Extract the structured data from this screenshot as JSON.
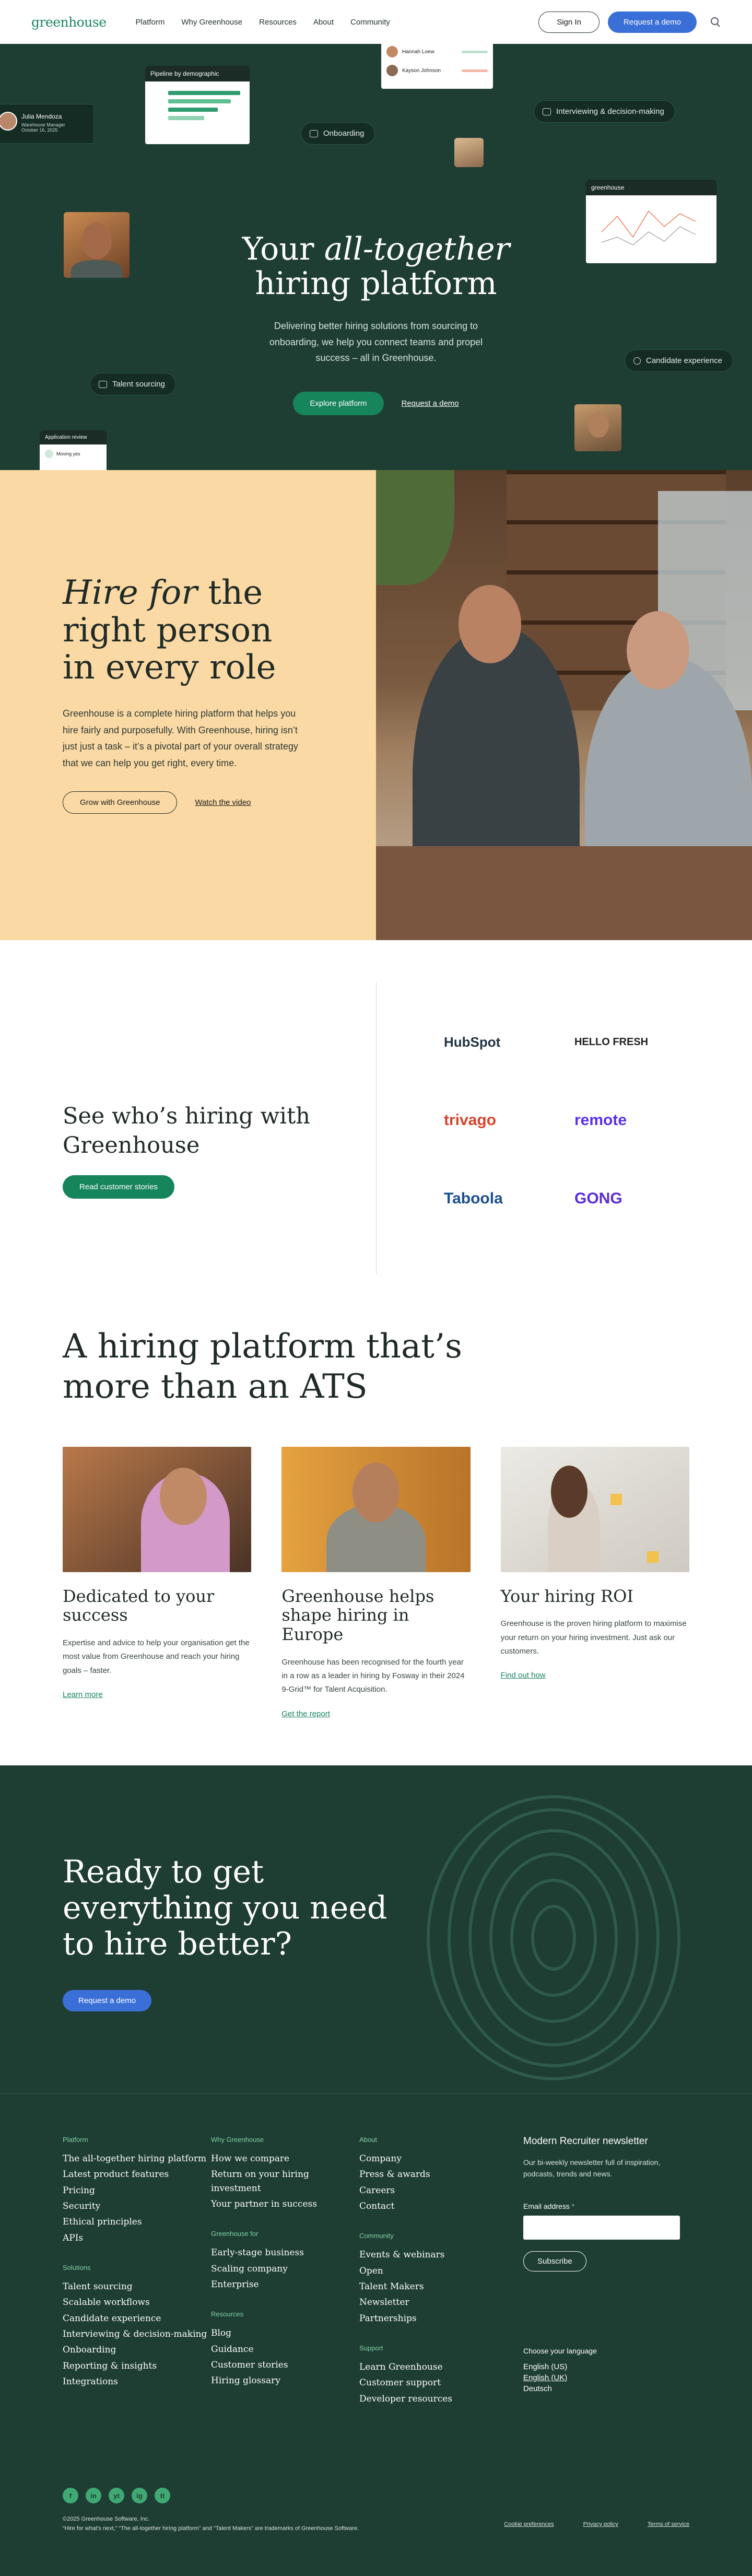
{
  "nav": {
    "logo": "greenhouse",
    "links": [
      "Platform",
      "Why Greenhouse",
      "Resources",
      "About",
      "Community"
    ],
    "signin": "Sign In",
    "demo": "Request a demo"
  },
  "hero": {
    "title_pre": "Your ",
    "title_em": "all-together",
    "title_post": "hiring platform",
    "subtitle": "Delivering better hiring solutions from sourcing to onboarding, we help you connect teams and propel success – all in Greenhouse.",
    "cta_primary": "Explore platform",
    "cta_secondary": "Request a demo",
    "pills": [
      "Onboarding",
      "Interviewing & decision-making",
      "Candidate experience",
      "Talent sourcing"
    ],
    "profile_card": {
      "name": "Julia Mendoza",
      "line1": "Warehouse Manager",
      "line2": "October 16, 2025"
    },
    "pipeline_card": {
      "title": "Pipeline by demographic"
    },
    "chart_card": {
      "title": "greenhouse"
    },
    "app_card": {
      "title": "Application review",
      "label": "Moving yes"
    },
    "top_card": {
      "row1": "Hannah Loew",
      "row2": "Kayson Johnson"
    }
  },
  "hire": {
    "title_em": "Hire for",
    "title_rest": " the right person in every role",
    "body": "Greenhouse is a complete hiring platform that helps you hire fairly and purposefully. With Greenhouse, hiring isn’t just just a task – it’s a pivotal part of your overall strategy that we can help you get right, every time.",
    "btn": "Grow with Greenhouse",
    "link": "Watch the video"
  },
  "who": {
    "title": "See who’s hiring with Greenhouse",
    "btn": "Read customer stories",
    "logos": [
      "HubSpot",
      "HELLO FRESH",
      "trivago",
      "remote",
      "Taboola",
      "GONG"
    ]
  },
  "ats": {
    "title": "A hiring platform that’s more than an ATS",
    "cards": [
      {
        "title": "Dedicated to your success",
        "body": "Expertise and advice to help your organisation get the most value from Greenhouse and reach your hiring goals – faster.",
        "link": "Learn more"
      },
      {
        "title": "Greenhouse helps shape hiring in Europe",
        "body": "Greenhouse has been recognised for the fourth year in a row as a leader in hiring by Fosway in their 2024 9-Grid™ for Talent Acquisition.",
        "link": "Get the report"
      },
      {
        "title": "Your hiring ROI",
        "body": "Greenhouse is the proven hiring platform to maximise your return on your hiring investment. Just ask our customers.",
        "link": "Find out how"
      }
    ]
  },
  "ready": {
    "title": "Ready to get everything you need to hire better?",
    "btn": "Request a demo"
  },
  "footer": {
    "platform": {
      "head": "Platform",
      "items": [
        "The all-together hiring platform",
        "Latest product features",
        "Pricing",
        "Security",
        "Ethical principles",
        "APIs"
      ]
    },
    "solutions": {
      "head": "Solutions",
      "items": [
        "Talent sourcing",
        "Scalable workflows",
        "Candidate experience",
        "Interviewing & decision-making",
        "Onboarding",
        "Reporting & insights",
        "Integrations"
      ]
    },
    "why": {
      "head": "Why Greenhouse",
      "items": [
        "How we compare",
        "Return on your hiring investment",
        "Your partner in success"
      ]
    },
    "for": {
      "head": "Greenhouse for",
      "items": [
        "Early-stage business",
        "Scaling company",
        "Enterprise"
      ]
    },
    "resources": {
      "head": "Resources",
      "items": [
        "Blog",
        "Guidance",
        "Customer stories",
        "Hiring glossary"
      ]
    },
    "about": {
      "head": "About",
      "items": [
        "Company",
        "Press & awards",
        "Careers",
        "Contact"
      ]
    },
    "community": {
      "head": "Community",
      "items": [
        "Events & webinars",
        "Open",
        "Talent Makers",
        "Newsletter",
        "Partnerships"
      ]
    },
    "support": {
      "head": "Support",
      "items": [
        "Learn Greenhouse",
        "Customer support",
        "Developer resources"
      ]
    },
    "newsletter": {
      "title": "Modern Recruiter newsletter",
      "body": "Our bi-weekly newsletter full of inspiration, podcasts, trends and news.",
      "email_label": "Email address",
      "required": "*",
      "subscribe": "Subscribe"
    },
    "language": {
      "label": "Choose your language",
      "options": [
        "English (US)",
        "English (UK)",
        "Deutsch"
      ]
    },
    "socials": [
      "f",
      "in",
      "yt",
      "ig",
      "tt"
    ],
    "copyright": "©2025 Greenhouse Software, Inc.",
    "trademark": "“Hire for what’s next,” “The all-together hiring platform” and “Talent Makers” are trademarks of Greenhouse Software.",
    "legal": [
      "Cookie preferences",
      "Privacy policy",
      "Terms of service"
    ]
  }
}
